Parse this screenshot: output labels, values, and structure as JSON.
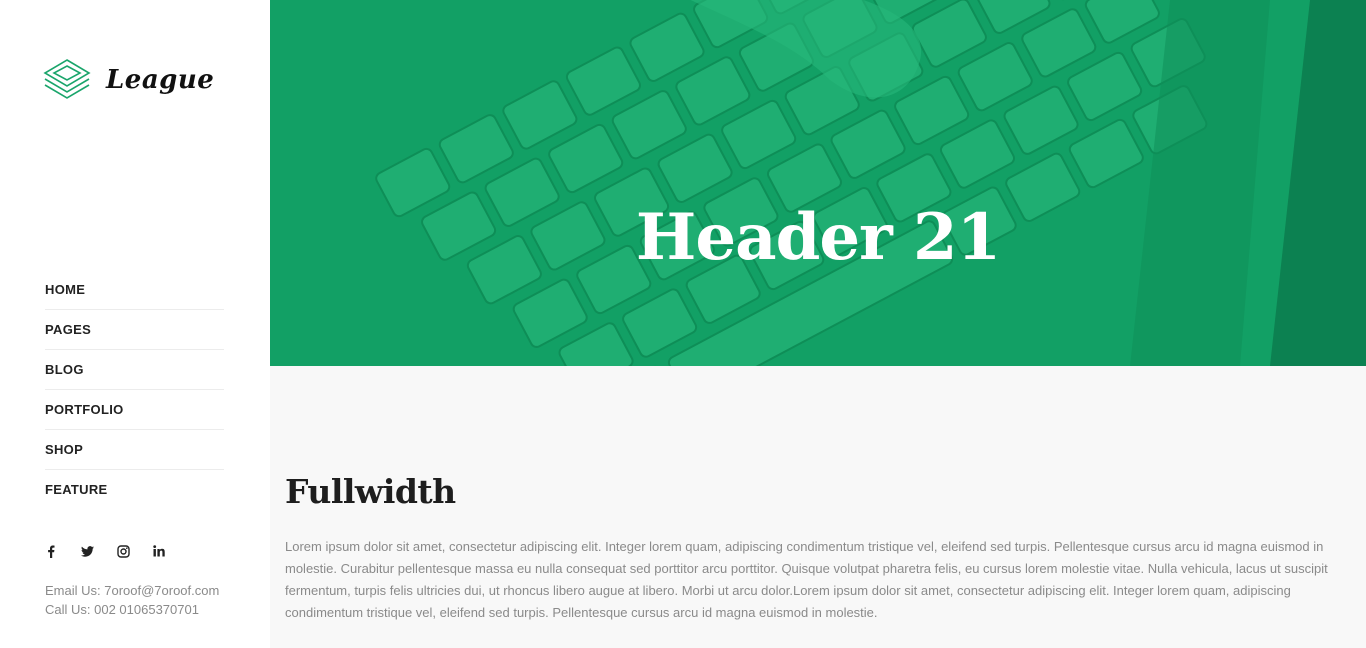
{
  "brand": {
    "name": "League",
    "accent_color": "#1aa56b"
  },
  "nav": {
    "items": [
      {
        "label": "HOME"
      },
      {
        "label": "PAGES"
      },
      {
        "label": "BLOG"
      },
      {
        "label": "PORTFOLIO"
      },
      {
        "label": "SHOP"
      },
      {
        "label": "FEATURE"
      }
    ]
  },
  "social": {
    "icons": [
      "facebook-icon",
      "twitter-icon",
      "instagram-icon",
      "linkedin-icon"
    ]
  },
  "contact": {
    "email_line": "Email Us: 7oroof@7oroof.com",
    "phone_line": "Call Us: 002 01065370701"
  },
  "hero": {
    "title": "Header 21",
    "overlay_color": "#13a267"
  },
  "content": {
    "heading": "Fullwidth",
    "body": "Lorem ipsum dolor sit amet, consectetur adipiscing elit. Integer lorem quam, adipiscing condimentum tristique vel, eleifend sed turpis. Pellentesque cursus arcu id magna euismod in molestie. Curabitur pellentesque massa eu nulla consequat sed porttitor arcu porttitor. Quisque volutpat pharetra felis, eu cursus lorem molestie vitae. Nulla vehicula, lacus ut suscipit fermentum, turpis felis ultricies dui, ut rhoncus libero augue at libero. Morbi ut arcu dolor.Lorem ipsum dolor sit amet, consectetur adipiscing elit. Integer lorem quam, adipiscing condimentum tristique vel, eleifend sed turpis. Pellentesque cursus arcu id magna euismod in molestie."
  }
}
